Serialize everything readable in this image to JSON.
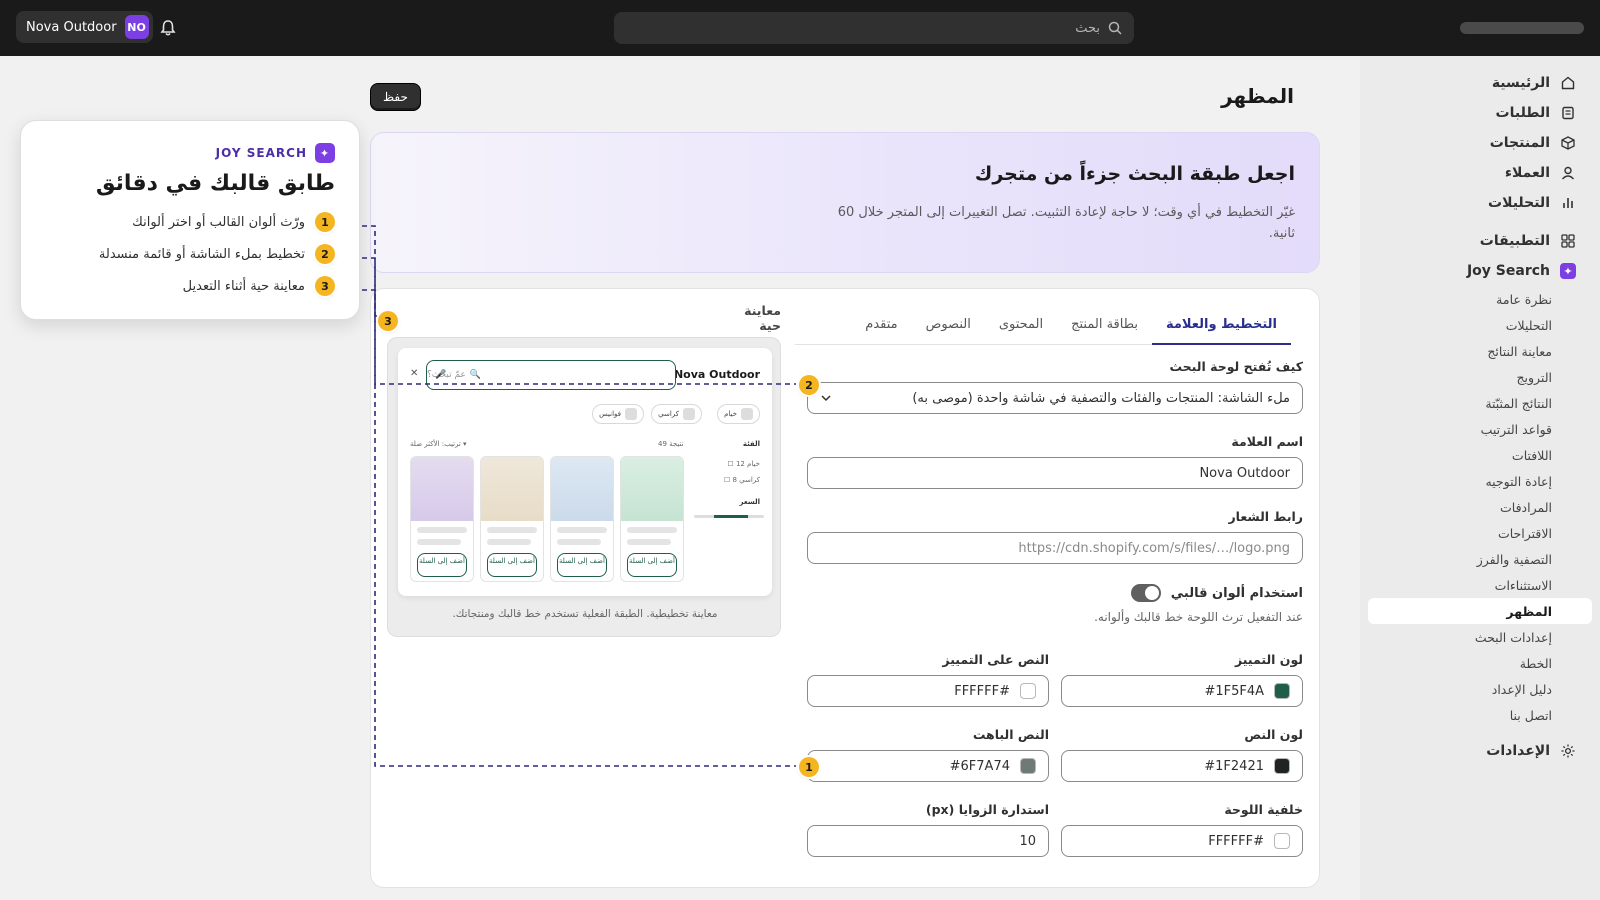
{
  "topbar": {
    "store_name": "Nova Outdoor",
    "store_initials": "NO",
    "search_placeholder": "بحث"
  },
  "sidebar": {
    "items": [
      {
        "label": "الرئيسية",
        "icon": "home-icon"
      },
      {
        "label": "الطلبات",
        "icon": "orders-icon"
      },
      {
        "label": "المنتجات",
        "icon": "products-icon"
      },
      {
        "label": "العملاء",
        "icon": "customers-icon"
      },
      {
        "label": "التحليلات",
        "icon": "analytics-icon"
      }
    ],
    "apps_label": "التطبيقات",
    "app_name": "Joy Search",
    "app_subitems": [
      "نظرة عامة",
      "التحليلات",
      "معاينة النتائج",
      "الترويج",
      "النتائج المثبّتة",
      "قواعد الترتيب",
      "اللافتات",
      "إعادة التوجيه",
      "المرادفات",
      "الاقتراحات",
      "التصفية والفرز",
      "الاستثناءات",
      "المظهر",
      "إعدادات البحث",
      "الخطة",
      "دليل الإعداد",
      "اتصل بنا"
    ],
    "active_subitem": "المظهر",
    "settings_label": "الإعدادات"
  },
  "page": {
    "title": "المظهر",
    "save_label": "حفظ"
  },
  "hero": {
    "title": "اجعل طبقة البحث جزءاً من متجرك",
    "description": "غيّر التخطيط في أي وقت؛ لا حاجة لإعادة التثبيت. تصل التغييرات إلى المتجر خلال 60 ثانية."
  },
  "tabs": [
    {
      "label": "التخطيط والعلامة",
      "active": true
    },
    {
      "label": "بطاقة المنتج",
      "active": false
    },
    {
      "label": "المحتوى",
      "active": false
    },
    {
      "label": "النصوص",
      "active": false
    },
    {
      "label": "متقدم",
      "active": false
    }
  ],
  "form": {
    "layout_label": "كيف تُفتح لوحة البحث",
    "layout_value": "ملء الشاشة: المنتجات والفئات والتصفية في شاشة واحدة (موصى به)",
    "brand_label": "اسم العلامة",
    "brand_value": "Nova Outdoor",
    "logo_label": "رابط الشعار",
    "logo_placeholder": "https://cdn.shopify.com/s/files/…/logo.png",
    "theme_colors_label": "استخدام ألوان قالبي",
    "theme_colors_enabled": true,
    "theme_colors_help": "عند التفعيل ترث اللوحة خط قالبك وألوانه.",
    "accent_label": "لون التمييز",
    "accent_value": "#1F5F4A",
    "on_accent_label": "النص على التمييز",
    "on_accent_value": "#FFFFFF",
    "text_label": "لون النص",
    "text_value": "#1F2421",
    "muted_label": "النص الباهت",
    "muted_value": "#6F7A74",
    "panel_bg_label": "خلفية اللوحة",
    "panel_bg_value": "#FFFFFF",
    "radius_label": "استدارة الزوايا (px)",
    "radius_value": "10"
  },
  "preview": {
    "label": "معاينة حية",
    "brand": "Nova Outdoor",
    "search_placeholder": "عمّ تبحث؟",
    "chips": [
      "خيام",
      "كراسي",
      "فوانيس"
    ],
    "category_heading": "الفئة",
    "results_count": "49 نتيجة",
    "sort_label": "ترتيب: الأكثر صلة ▾",
    "filter_1": "☐ خيام 12",
    "filter_2": "☐ كراسي 8",
    "price_heading": "السعر",
    "add_to_cart": "أضف إلى السلة",
    "caption": "معاينة تخطيطية. الطبقة الفعلية تستخدم خط قالبك ومنتجاتك.",
    "product_tints": [
      "#d9efe2",
      "#dde8f3",
      "#efe7da",
      "#e5dcef"
    ]
  },
  "tutorial": {
    "kicker": "JOY SEARCH",
    "title": "طابق قالبك في دقائق",
    "steps": [
      {
        "num": "1",
        "text": "ورّث ألوان القالب أو اختر ألوانك"
      },
      {
        "num": "2",
        "text": "تخطيط بملء الشاشة أو قائمة منسدلة"
      },
      {
        "num": "3",
        "text": "معاينة حية أثناء التعديل"
      }
    ]
  },
  "colors": {
    "accent": "#1F5F4A",
    "brand_purple": "#7B3FE4",
    "step_badge": "#F5B521",
    "connector": "#2B2A7A"
  }
}
